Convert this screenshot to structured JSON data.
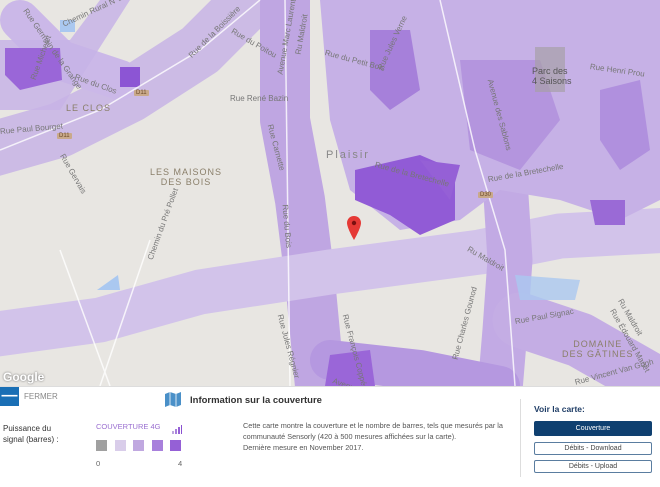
{
  "map": {
    "street_labels": [
      "Chemin Rural N°13",
      "Rue Germain de la Grange",
      "Rue Michelet",
      "Rue du Clos",
      "Rue de la Boissière",
      "Rue du Poitou",
      "Avenue Marc Laurent",
      "Ru Maldroit",
      "Rue René Bazin",
      "Rue Carnette",
      "Rue du Bois",
      "Rue Jules Verne",
      "Rue du Petit Bois",
      "Avenue des Sablons",
      "Rue Henri Prou",
      "Rue de la Bretechelle",
      "Rue de la Bretechelle",
      "Rue Gervais",
      "Rue Paul Bourget",
      "Chemin du Pré Pollet",
      "Rue Jules Régnier",
      "Rue François Coppée",
      "Ru Maldroit",
      "Rue Paul Signac",
      "Rue Charles Gounod",
      "Rue Édouard Manet",
      "Ru Maldroit",
      "Rue Vincent Van Gogh",
      "Avenue"
    ],
    "place_labels": [
      "LE CLOS",
      "LES MAISONS\nDES BOIS",
      "Plaisir",
      "Parc des\n4 Saisons",
      "DOMAINE\nDES GÂTINES"
    ],
    "road_shields": [
      "D11",
      "D11",
      "D30"
    ],
    "attribution": "Google"
  },
  "panel": {
    "close_label": "FERMER",
    "close_symbol": "—",
    "legend_title": "Puissance du signal (barres) :",
    "coverage_label": "COUVERTURE 4G",
    "scale_min": "0",
    "scale_max": "4",
    "swatch_colors": [
      "#a0a0a0",
      "#d9cdea",
      "#c0a8e0",
      "#a880dc",
      "#9560d6"
    ],
    "info_title": "Information sur la couverture",
    "description_line1": "Cette carte montre la couverture et le nombre de barres, tels que mesurés par la",
    "description_line2": "communauté Sensorly (420 à 500 mesures affichées sur la carte).",
    "description_line3": "Dernière mesure en November 2017.",
    "view_title": "Voir la carte:",
    "buttons": [
      "Couverture",
      "Débits - Download",
      "Débits - Upload"
    ]
  }
}
